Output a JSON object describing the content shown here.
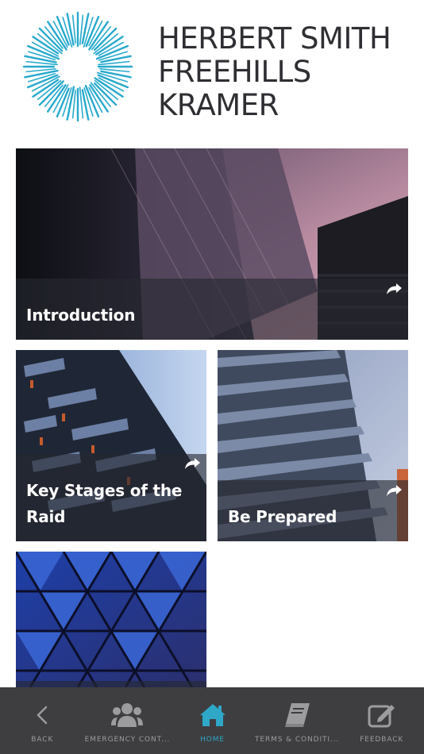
{
  "brand": {
    "logo_lines": [
      "HERBERT SMITH",
      "FREEHILLS",
      "KRAMER"
    ],
    "mark_color": "#27a9cc",
    "text_color": "#2f2f33"
  },
  "tiles": [
    {
      "title": "Introduction",
      "share_icon": "share-arrow-icon"
    },
    {
      "title_lines": [
        "Key Stages of the",
        "Raid"
      ],
      "share_icon": "share-arrow-icon"
    },
    {
      "title": "Be Prepared",
      "share_icon": "share-arrow-icon"
    },
    {
      "title": ""
    }
  ],
  "bottom_nav": {
    "items": [
      {
        "label": "BACK",
        "icon": "chevron-left-icon",
        "active": false
      },
      {
        "label": "EMERGENCY CONT...",
        "icon": "users-group-icon",
        "active": false
      },
      {
        "label": "HOME",
        "icon": "home-icon",
        "active": true
      },
      {
        "label": "TERMS & CONDITI...",
        "icon": "book-icon",
        "active": false
      },
      {
        "label": "FEEDBACK",
        "icon": "edit-icon",
        "active": false
      }
    ],
    "active_color": "#2fa8c8",
    "inactive_color": "#9c9c9e",
    "background": "#3e3e40"
  }
}
